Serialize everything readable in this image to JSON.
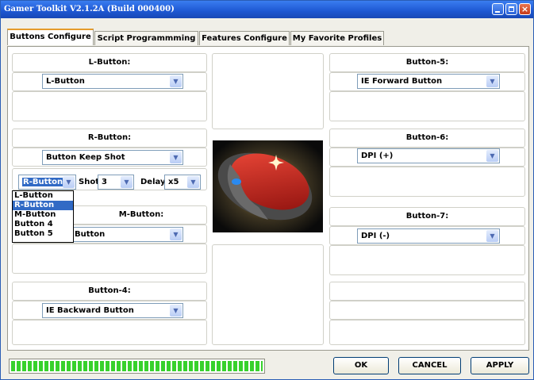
{
  "window": {
    "title": "Gamer Toolkit V2.1.2A (Build 000400)"
  },
  "tabs": [
    {
      "label": "Buttons Configure",
      "active": true
    },
    {
      "label": "Script Programmming",
      "active": false
    },
    {
      "label": "Features Configure",
      "active": false
    },
    {
      "label": "My Favorite Profiles",
      "active": false
    }
  ],
  "left": {
    "l_button": {
      "title": "L-Button:",
      "value": "L-Button"
    },
    "r_button": {
      "title": "R-Button:",
      "value": "Button Keep Shot"
    },
    "shot_row": {
      "button_value": "R-Button",
      "shot_label": "Shot",
      "shot_value": "3",
      "delay_label": "Delay",
      "delay_value": "x5"
    },
    "dropdown_options": [
      "L-Button",
      "R-Button",
      "M-Button",
      "Button 4",
      "Button 5"
    ],
    "dropdown_selected": "R-Button",
    "m_button": {
      "title": "M-Button:",
      "value": "Button"
    },
    "button4": {
      "title": "Button-4:",
      "value": "IE Backward Button"
    }
  },
  "right": {
    "button5": {
      "title": "Button-5:",
      "value": "IE Forward Button"
    },
    "button6": {
      "title": "Button-6:",
      "value": "DPI (+)"
    },
    "button7": {
      "title": "Button-7:",
      "value": "DPI (-)"
    }
  },
  "footer": {
    "progress": 1.0,
    "ok_label": "OK",
    "cancel_label": "CANCEL",
    "apply_label": "APPLY"
  },
  "colors": {
    "title_bar": "#1d57d2",
    "progress_fill": "#37d12c",
    "selection": "#316ac5",
    "active_tab_accent": "#e59b2a"
  }
}
